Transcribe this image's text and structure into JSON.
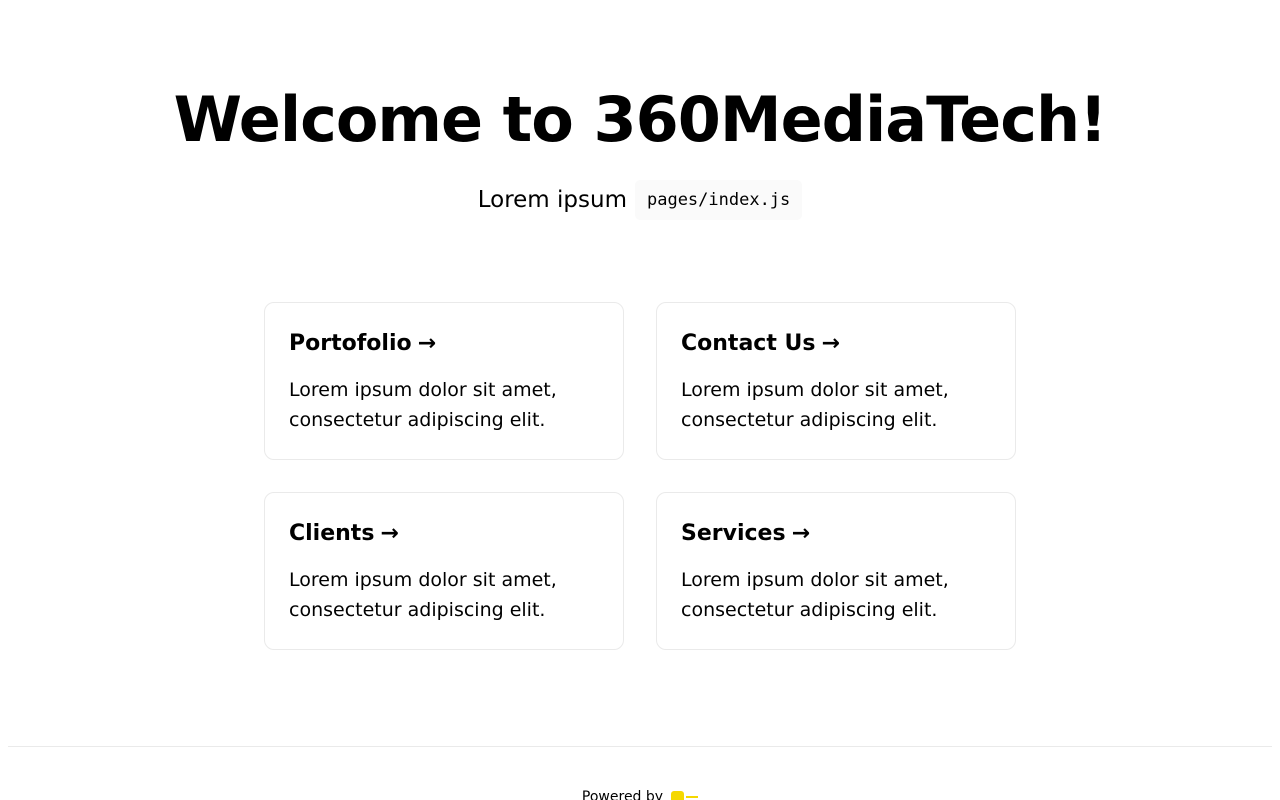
{
  "header": {
    "title": "Welcome to 360MediaTech!",
    "subtitle_text": "Lorem ipsum",
    "subtitle_code": "pages/index.js"
  },
  "cards": [
    {
      "title": "Portofolio",
      "arrow": "→",
      "description": "Lorem ipsum dolor sit amet, consectetur adipiscing elit."
    },
    {
      "title": "Contact Us",
      "arrow": "→",
      "description": "Lorem ipsum dolor sit amet, consectetur adipiscing elit."
    },
    {
      "title": "Clients",
      "arrow": "→",
      "description": "Lorem ipsum dolor sit amet, consectetur adipiscing elit."
    },
    {
      "title": "Services",
      "arrow": "→",
      "description": "Lorem ipsum dolor sit amet, consectetur adipiscing elit."
    }
  ],
  "footer": {
    "powered_by": "Powered by",
    "logo_icon": "vercel-logo-icon"
  },
  "colors": {
    "border": "#eaeaea",
    "code_background": "#fafafa",
    "logo": "#f5d800"
  }
}
